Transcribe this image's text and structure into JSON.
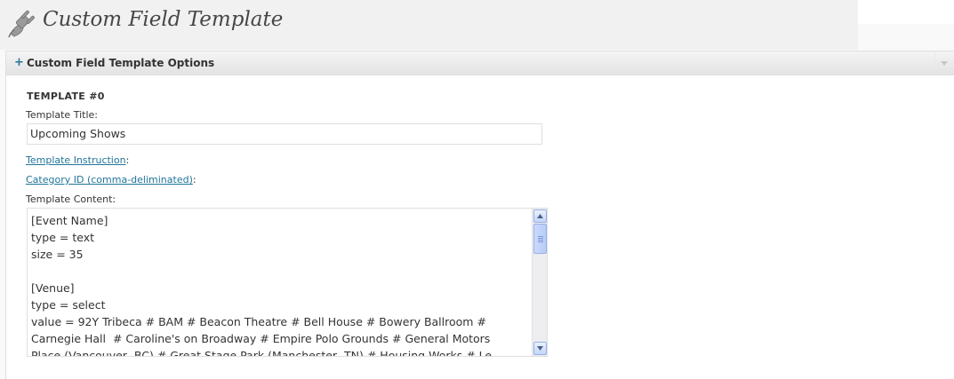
{
  "header": {
    "title": "Custom Field Template",
    "icon": "plugin-plug-icon"
  },
  "postbox": {
    "title": "Custom Field Template Options",
    "toggle_symbol": "+"
  },
  "template": {
    "heading": "TEMPLATE #0",
    "title_label": "Template Title:",
    "title_value": "Upcoming Shows",
    "instruction_link": "Template Instruction",
    "instruction_suffix": ":",
    "category_link": "Category ID (comma-deliminated)",
    "category_suffix": ":",
    "content_label": "Template Content:",
    "content_value": "[Event Name]\ntype = text\nsize = 35\n\n[Venue]\ntype = select\nvalue = 92Y Tribeca # BAM # Beacon Theatre # Bell House # Bowery Ballroom #\nCarnegie Hall  # Caroline's on Broadway # Empire Polo Grounds # General Motors\nPlace (Vancouver, BC) # Great Stage Park (Manchester, TN) # Housing Works # Le"
  },
  "colors": {
    "link": "#21759b",
    "text": "#333333",
    "title": "#464646"
  }
}
